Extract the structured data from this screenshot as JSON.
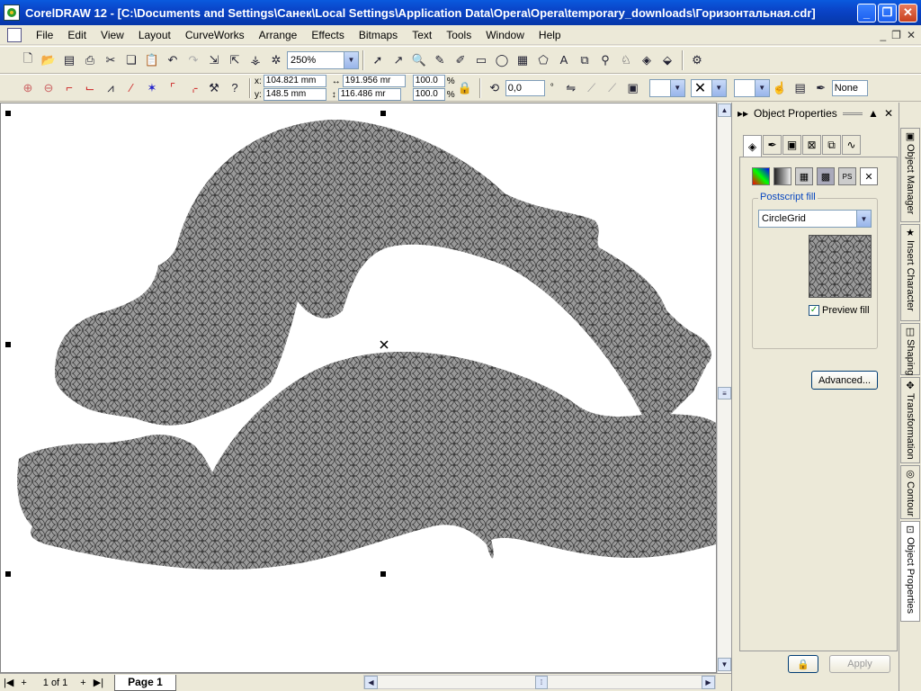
{
  "window": {
    "title": "CorelDRAW 12 - [C:\\Documents and Settings\\Санек\\Local Settings\\Application Data\\Opera\\Opera\\temporary_downloads\\Горизонтальная.cdr]",
    "minimize": "_",
    "restore": "❐",
    "close": "✕"
  },
  "menu": [
    "File",
    "Edit",
    "View",
    "Layout",
    "CurveWorks",
    "Arrange",
    "Effects",
    "Bitmaps",
    "Text",
    "Tools",
    "Window",
    "Help"
  ],
  "zoom": "250%",
  "property_bar": {
    "x": "104.821 mm",
    "y": "148.5 mm",
    "width": "191.956 mr",
    "height": "116.486 mr",
    "scale_x": "100.0",
    "scale_y": "100.0",
    "pct": "%",
    "rotation": "0,0",
    "degree": "°",
    "outline": "None"
  },
  "docker": {
    "title": "Object Properties",
    "group_title": "Postscript fill",
    "fill_name": "CircleGrid",
    "preview_label": "Preview fill",
    "preview_checked": true,
    "advanced_button": "Advanced...",
    "apply_button": "Apply"
  },
  "side_tabs": [
    "Object Manager",
    "Insert Character",
    "Shaping",
    "Transformation",
    "Contour",
    "Object Properties"
  ],
  "pages": {
    "counter": "1 of 1",
    "current_tab": "Page 1"
  },
  "colors": {
    "titlebar": "#0a44c8",
    "shape_fill": "#9a9a9a",
    "pattern_line": "#333333"
  }
}
